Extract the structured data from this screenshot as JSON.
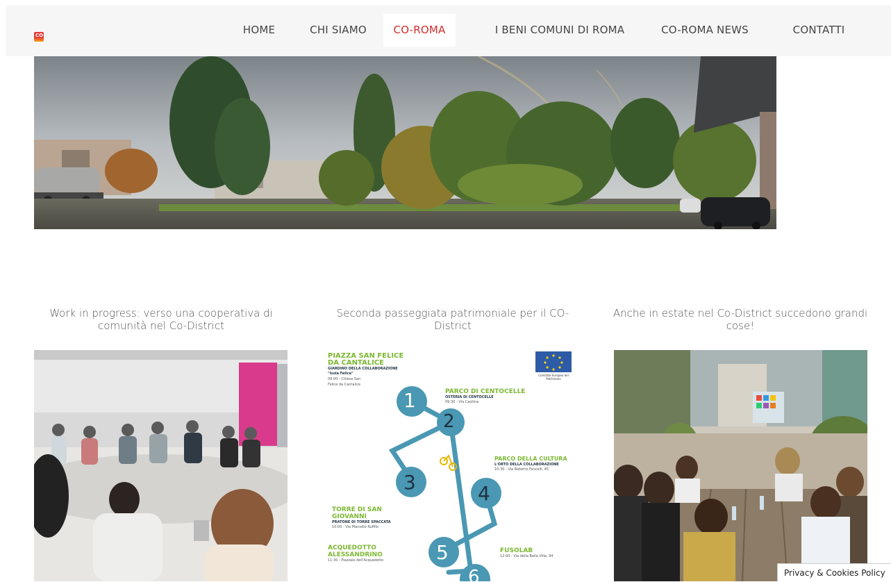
{
  "nav": {
    "items": [
      {
        "label": "HOME"
      },
      {
        "label": "CHI SIAMO"
      },
      {
        "label": "CO-ROMA"
      },
      {
        "label": "I BENI COMUNI DI ROMA"
      },
      {
        "label": "CO-ROMA NEWS"
      },
      {
        "label": "CONTATTI"
      }
    ],
    "active_color": "#d22b2b",
    "logo_text": "CO"
  },
  "posts": [
    {
      "title": "Work in progress: verso una cooperativa di comunità nel Co-District"
    },
    {
      "title": "Seconda passeggiata patrimoniale per il CO-District"
    },
    {
      "title": "Anche in estate nel Co-District succedono grandi cose!"
    }
  ],
  "poster": {
    "stops": [
      {
        "title": "PIAZZA SAN FELICE DA CANTALICE",
        "subtitle": "GIARDINO DELLA COLLABORAZIONE \"Isola Felice\"",
        "detail": "09:00 - Chiesa San Felice da Cantalice"
      },
      {
        "title": "PARCO DI CENTOCELLE",
        "subtitle": "OSTERIA DI CENTOCELLE",
        "detail": "09:30 - Via Casilina"
      },
      {
        "title": "PARCO DELLA CULTURA",
        "subtitle": "L'ORTO DELLA COLLABORAZIONE",
        "detail": "10:30 - Via Roberto Fancelli, 45"
      },
      {
        "title": "TORRE DI SAN GIOVANNI",
        "subtitle": "PRATONE DI TORRE SPACCATA",
        "detail": "10:00 - Via Marcello Ruffilo"
      },
      {
        "title": "ACQUEDOTTO ALESSANDRINO",
        "subtitle": "",
        "detail": "11:30 - Piazzale dell'Acquedotto"
      },
      {
        "title": "FUSOLAB",
        "subtitle": "",
        "detail": "12:00 - Via della Bella Villa, 94"
      }
    ],
    "numbers": [
      "1",
      "2",
      "3",
      "4",
      "5",
      "6"
    ],
    "eu_caption": "Comitato Europeo del Patrimonio"
  },
  "privacy": {
    "label": "Privacy & Cookies Policy"
  }
}
